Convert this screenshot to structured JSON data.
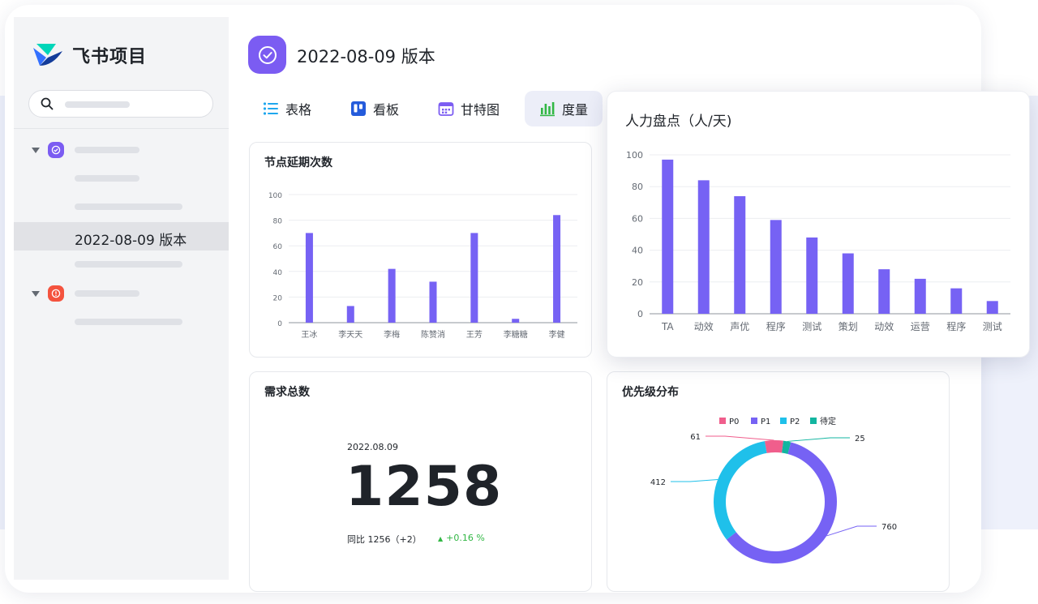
{
  "brand": {
    "name": "飞书项目"
  },
  "sidebar": {
    "selected_label": "2022-08-09 版本"
  },
  "project": {
    "title": "2022-08-09 版本"
  },
  "tabs": [
    {
      "label": "表格",
      "icon": "list-icon"
    },
    {
      "label": "看板",
      "icon": "kanban-icon"
    },
    {
      "label": "甘特图",
      "icon": "calendar-icon"
    },
    {
      "label": "度量",
      "icon": "bar-chart-icon"
    }
  ],
  "colors": {
    "accent": "#7b5cf2",
    "bar": "#7662f4",
    "green": "#31b744",
    "red": "#f4533e"
  },
  "summary": {
    "title": "需求总数",
    "date": "2022.08.09",
    "value": "1258",
    "yoy_label": "同比 1256（+2）",
    "change": "+0.16 %"
  },
  "chart_data": [
    {
      "type": "bar",
      "title": "节点延期次数",
      "categories": [
        "王冰",
        "李天天",
        "李梅",
        "陈赞消",
        "王芳",
        "李糖糖",
        "李健"
      ],
      "values": [
        70,
        13,
        42,
        32,
        70,
        3,
        84
      ],
      "ylim": [
        0,
        100
      ],
      "yticks": [
        0,
        20,
        40,
        60,
        80,
        100
      ]
    },
    {
      "type": "bar",
      "title": "人力盘点（人/天)",
      "categories": [
        "TA",
        "动效",
        "声优",
        "程序",
        "测试",
        "策划",
        "动效",
        "运营",
        "程序",
        "测试"
      ],
      "values": [
        97,
        84,
        74,
        59,
        48,
        38,
        28,
        22,
        16,
        8
      ],
      "ylim": [
        0,
        100
      ],
      "yticks": [
        0,
        20,
        40,
        60,
        80,
        100
      ]
    },
    {
      "type": "pie",
      "title": "优先级分布",
      "legend": "top",
      "labels": [
        "P0",
        "P1",
        "P2",
        "待定"
      ],
      "values": [
        61,
        760,
        412,
        25
      ],
      "colors": [
        "#f05e8c",
        "#7662f4",
        "#1fc0ea",
        "#12b5a0"
      ]
    }
  ]
}
